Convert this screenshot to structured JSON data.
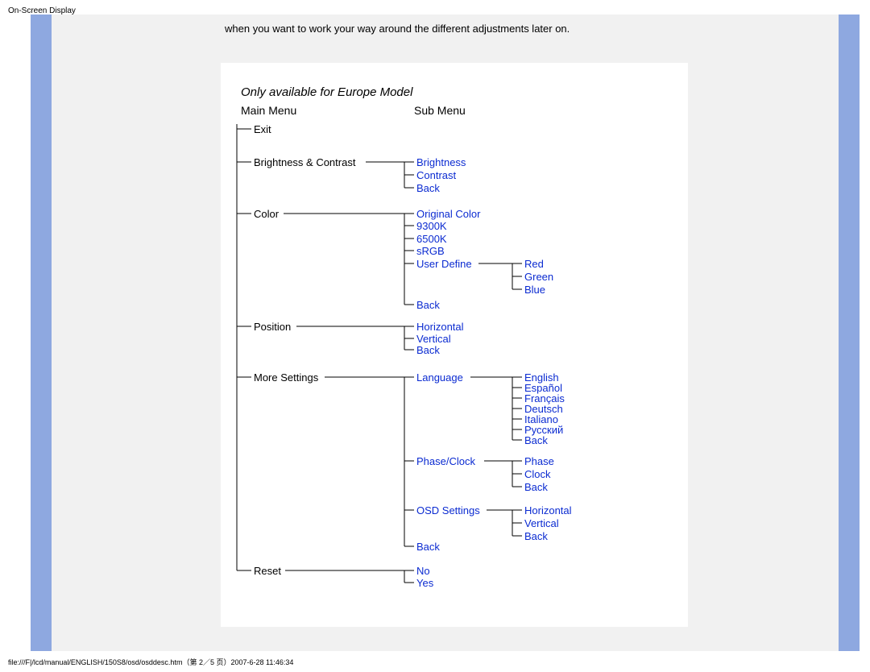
{
  "page_title": "On-Screen Display",
  "intro": "when you want to work your way around the different adjustments later on.",
  "diagram_note": "Only available for Europe Model",
  "headers": {
    "main": "Main Menu",
    "sub": "Sub Menu"
  },
  "main": {
    "exit": "Exit",
    "brightness_contrast": "Brightness & Contrast",
    "color": "Color",
    "position": "Position",
    "more_settings": "More Settings",
    "reset": "Reset"
  },
  "sub": {
    "brightness": "Brightness",
    "contrast": "Contrast",
    "back": "Back",
    "original_color": "Original Color",
    "k9300": "9300K",
    "k6500": "6500K",
    "srgb": "sRGB",
    "user_define": "User Define",
    "red": "Red",
    "green": "Green",
    "blue": "Blue",
    "horizontal": "Horizontal",
    "vertical": "Vertical",
    "language": "Language",
    "english": "English",
    "espanol": "Español",
    "francais": "Français",
    "deutsch": "Deutsch",
    "italiano": "Italiano",
    "russkij": "Русский",
    "phase_clock": "Phase/Clock",
    "phase": "Phase",
    "clock": "Clock",
    "osd_settings": "OSD Settings",
    "no": "No",
    "yes": "Yes"
  },
  "footer": "file:///F|/lcd/manual/ENGLISH/150S8/osd/osddesc.htm（第 2／5 页）2007-6-28 11:46:34"
}
